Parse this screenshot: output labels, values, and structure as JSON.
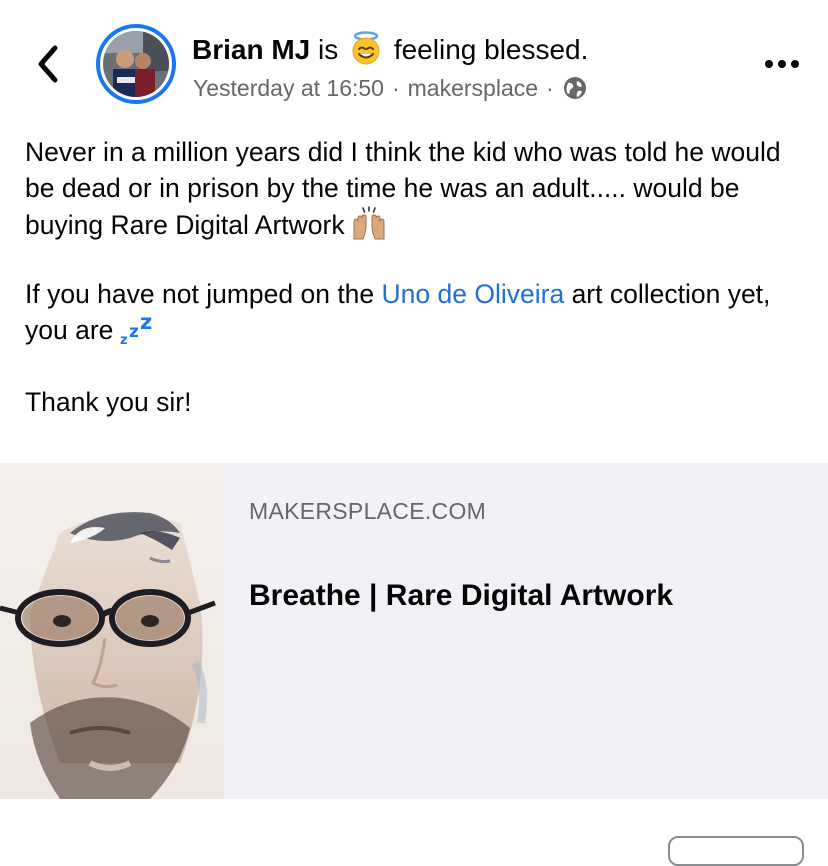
{
  "post": {
    "author": "Brian MJ",
    "is": "is",
    "feeling": "feeling blessed.",
    "time": "Yesterday at 16:50",
    "separator": "·",
    "source": "makersplace",
    "paragraphs": {
      "p1": "Never in a million years did I think the kid who was told he would be dead or in prison by the time he was an adult..... would be buying Rare Digital Artwork",
      "p2_before": "If you have not jumped on the",
      "p2_mention": "Uno de Oliveira",
      "p2_after": "art collection yet, you are",
      "p3": "Thank you sir!"
    }
  },
  "link_card": {
    "domain": "MAKERSPLACE.COM",
    "title": "Breathe | Rare Digital Artwork"
  },
  "icons": {
    "back": "chevron-left-icon",
    "more": "more-horizontal-icon",
    "globe": "globe-icon",
    "halo": "smiling-face-with-halo-emoji",
    "raise": "raising-hands-emoji",
    "zzz": "zzz-emoji"
  },
  "colors": {
    "accent": "#1877f2",
    "mention": "#216fdb",
    "meta": "#65676b",
    "card_bg": "#f0f2f5"
  }
}
